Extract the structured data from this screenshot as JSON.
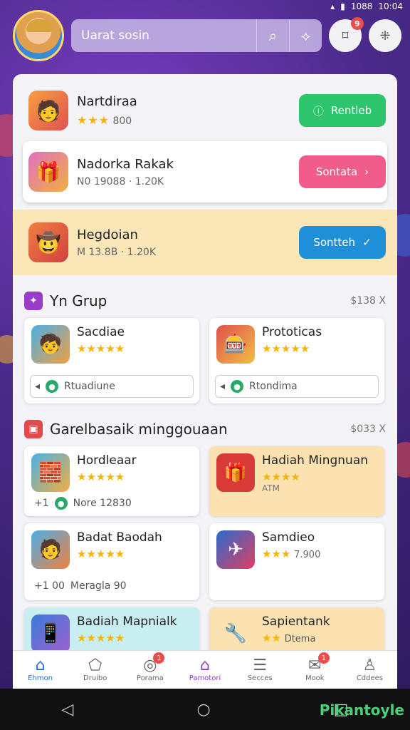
{
  "status": {
    "time": "10:04",
    "extra": "1088"
  },
  "search": {
    "placeholder": "Uarat sosin"
  },
  "header": {
    "notif_count": "9"
  },
  "featured": [
    {
      "title": "Nartdiraa",
      "stars": "★★★",
      "meta": "800",
      "button": "Rentleb",
      "icon": "🧑"
    },
    {
      "title": "Nadorka Rakak",
      "meta": "N0 19088 · 1.20K",
      "button": "Sontata",
      "icon": "🎁"
    },
    {
      "title": "Hegdoian",
      "meta": "M 13.8B · 1.20K",
      "button": "Sontteh",
      "icon": "🤠"
    }
  ],
  "section1": {
    "title": "Yn Grup",
    "right": "$138 X",
    "tiles": [
      {
        "title": "Sacdiae",
        "stars": "★★★★★",
        "foot": "Rtuadiune",
        "icon": "🧒"
      },
      {
        "title": "Prototicas",
        "stars": "★★★★★",
        "foot": "Rtondima",
        "icon": "🎰"
      }
    ]
  },
  "section2": {
    "title": "Garelbasaik minggouaan",
    "right": "$033 X",
    "tiles": [
      {
        "title": "Hordleaar",
        "stars": "★★★★★",
        "foot": "Nore 12830",
        "foot_left": "+1",
        "icon": "🧱"
      },
      {
        "title": "Hadiah Mingnuan",
        "stars": "★★★★",
        "foot": "",
        "sub": "ATM",
        "icon": "🎁"
      },
      {
        "title": "Badat Baodah",
        "stars": "★★★★★",
        "foot": "Meragla 90",
        "foot_left": "+1 00",
        "icon": "🧑"
      },
      {
        "title": "Samdieo",
        "stars": "★★★",
        "foot": "",
        "sub": "7.900",
        "icon": "✈"
      },
      {
        "title": "Badiah Mapnialk",
        "stars": "★★★★★",
        "foot": "",
        "icon": "📱"
      },
      {
        "title": "Sapientank",
        "stars": "★★",
        "foot": "",
        "sub": "Dtema",
        "icon": "🔧"
      }
    ]
  },
  "nav": [
    {
      "label": "Ehmon",
      "icon": "⌂"
    },
    {
      "label": "Druibo",
      "icon": "⬠"
    },
    {
      "label": "Porama",
      "icon": "◎"
    },
    {
      "label": "Pamotori",
      "icon": "⌂"
    },
    {
      "label": "Secces",
      "icon": "☰"
    },
    {
      "label": "Mook",
      "icon": "✉"
    },
    {
      "label": "Cddees",
      "icon": "♙"
    }
  ],
  "brand": "Pikantoyle",
  "colors": {
    "accent_green": "#2cc56b",
    "accent_pink": "#f25c8a",
    "accent_blue": "#1f8fd8"
  }
}
